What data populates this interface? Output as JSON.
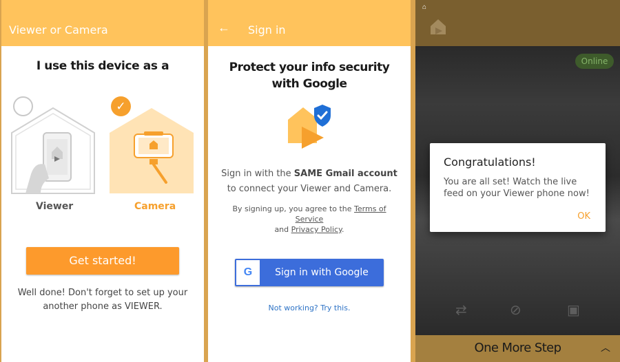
{
  "panel1": {
    "title": "Viewer or Camera",
    "heading": "I use this device as a",
    "options": [
      "Viewer",
      "Camera"
    ],
    "selected": "Camera",
    "start_button": "Get started!",
    "note": "Well done! Don't forget to set up your another phone as VIEWER."
  },
  "panel2": {
    "title": "Sign in",
    "heading": "Protect your info security with Google",
    "text_pre": "Sign in with the ",
    "text_bold": "SAME Gmail account",
    "text_post": " to connect your Viewer and Camera.",
    "small_pre": "By signing up, you agree to the ",
    "terms_link": "Terms of Service",
    "small_and": "and",
    "privacy_link": "Privacy Policy",
    "small_end": ".",
    "google_button": "Sign in with Google",
    "google_letter": "G",
    "help_link": "Not working? Try this."
  },
  "panel3": {
    "badge": "Online",
    "dialog_title": "Congratulations!",
    "dialog_message": "You are all set! Watch the live feed on your Viewer phone now!",
    "dialog_ok": "OK",
    "bottom_label": "One More Step"
  },
  "colors": {
    "accent": "#f6a02d",
    "appbar": "#ffc35c",
    "google_blue": "#3c6ddb",
    "link": "#2e73c6"
  },
  "icons": [
    "check-icon",
    "back-arrow-icon",
    "home-icon",
    "switch-camera-icon",
    "mute-icon",
    "lock-icon",
    "chevron-up-icon",
    "google-g-icon"
  ]
}
